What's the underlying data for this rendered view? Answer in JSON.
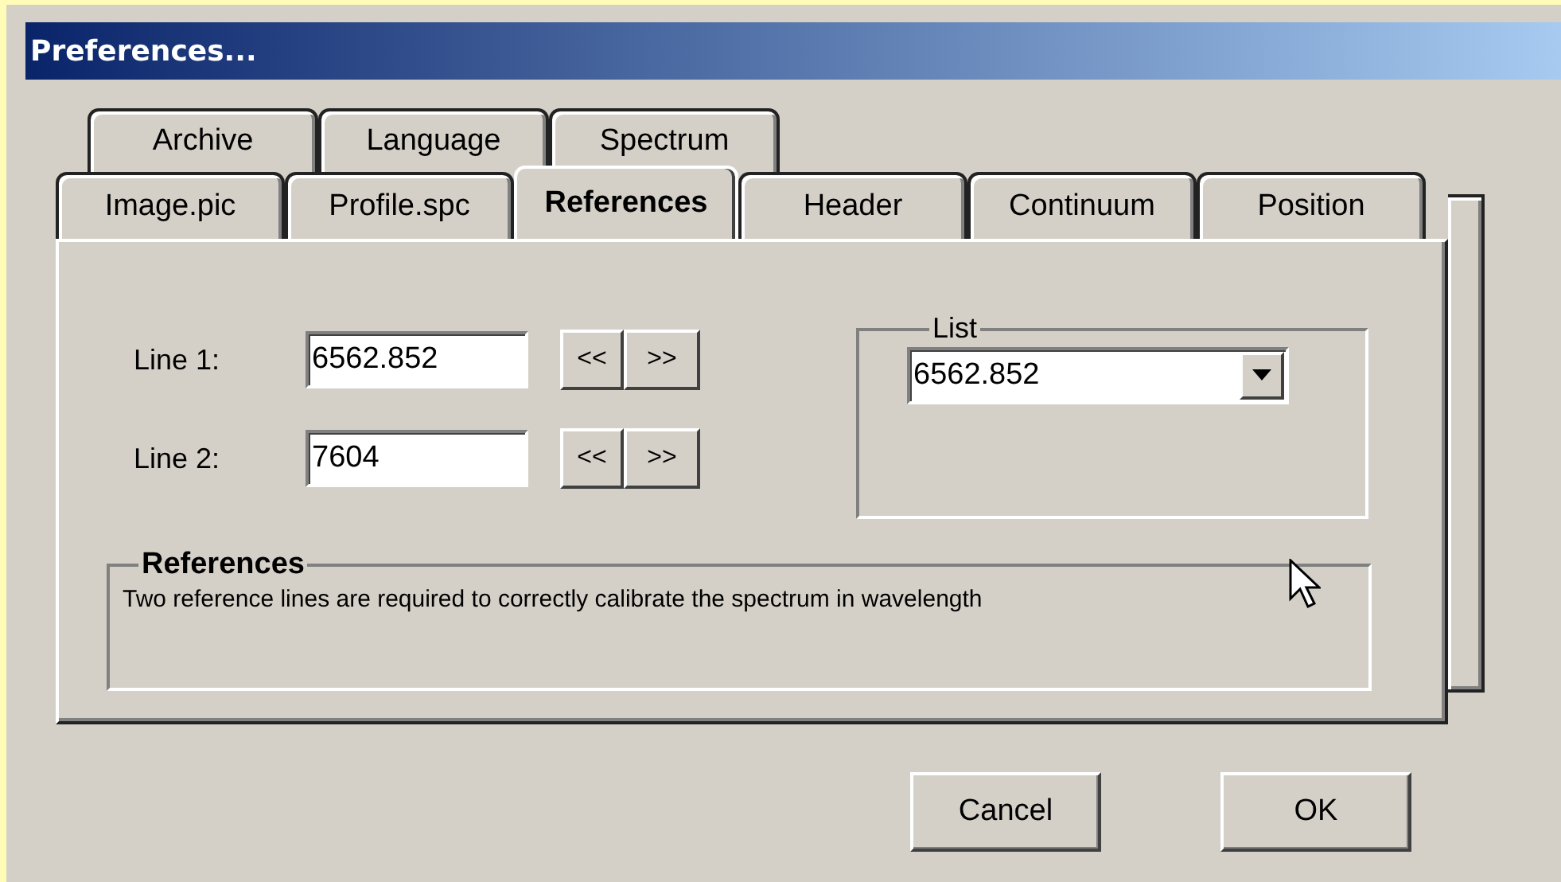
{
  "window": {
    "title": "Preferences..."
  },
  "tab_rows": [
    [
      {
        "label": "Archive",
        "selected": false
      },
      {
        "label": "Language",
        "selected": false
      },
      {
        "label": "Spectrum",
        "selected": false
      }
    ],
    [
      {
        "label": "Image.pic",
        "selected": false
      },
      {
        "label": "Profile.spc",
        "selected": false
      },
      {
        "label": "References",
        "selected": true
      },
      {
        "label": "Header",
        "selected": false
      },
      {
        "label": "Continuum",
        "selected": false
      },
      {
        "label": "Position",
        "selected": false
      }
    ]
  ],
  "lines": [
    {
      "label": "Line 1:",
      "value": "6562.852",
      "prev": "<<",
      "next": ">>"
    },
    {
      "label": "Line 2:",
      "value": "7604",
      "prev": "<<",
      "next": ">>"
    }
  ],
  "list_group": {
    "legend": "List",
    "dropdown": {
      "value": "6562.852"
    }
  },
  "info_group": {
    "legend": "References",
    "text": "Two reference lines are required to correctly calibrate the spectrum in wavelength"
  },
  "buttons": [
    {
      "label": "Cancel"
    },
    {
      "label": "OK"
    }
  ]
}
